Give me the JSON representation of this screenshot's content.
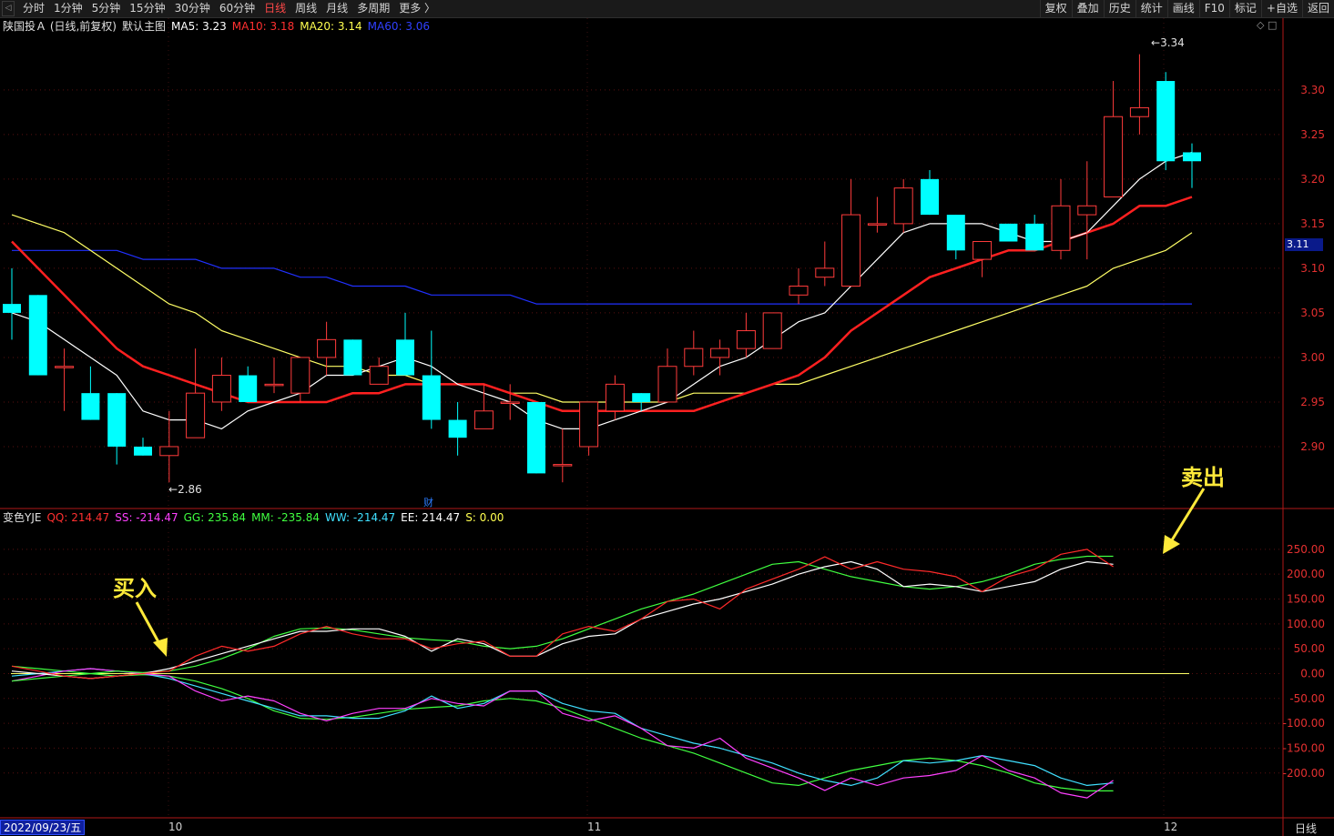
{
  "toolbar": {
    "periods": [
      "分时",
      "1分钟",
      "5分钟",
      "15分钟",
      "30分钟",
      "60分钟",
      "日线",
      "周线",
      "月线",
      "多周期",
      "更多 〉"
    ],
    "active_period": "日线",
    "right_buttons": [
      "复权",
      "叠加",
      "历史",
      "统计",
      "画线",
      "F10",
      "标记",
      "+自选",
      "返回"
    ]
  },
  "main_legend": {
    "stock": "陕国投Ａ (日线,前复权)",
    "template": "默认主图",
    "ma5": "MA5: 3.23",
    "ma10": "MA10: 3.18",
    "ma20": "MA20: 3.14",
    "ma60": "MA60: 3.06"
  },
  "indicator_legend": {
    "name": "变色YJE",
    "qq": "QQ: 214.47",
    "ss": "SS: -214.47",
    "gg": "GG: 235.84",
    "mm": "MM: -235.84",
    "ww": "WW: -214.47",
    "ee": "EE: 214.47",
    "s": "S: 0.00"
  },
  "colors": {
    "up": "#ff3b3b",
    "down": "#00ffff",
    "ma5": "#ffffff",
    "ma10": "#ff2020",
    "ma20": "#ffff66",
    "ma60": "#2030ff",
    "qq": "#ff2a2a",
    "ss": "#ff40ff",
    "gg": "#40ff40",
    "mm": "#40ff40",
    "ww": "#40e0ff",
    "ee": "#ffffff",
    "zero": "#ffff66"
  },
  "price_axis": [
    "3.30",
    "3.25",
    "3.20",
    "3.15",
    "3.10",
    "3.05",
    "3.00",
    "2.95",
    "2.90"
  ],
  "indicator_axis": [
    "250.00",
    "200.00",
    "150.00",
    "100.00",
    "50.00",
    "0.00",
    "-50.00",
    "-100.00",
    "-150.00",
    "-200.00"
  ],
  "current_price_tag": "3.11",
  "date_box": "2022/09/23/五",
  "period_label": "日线",
  "month_ticks": [
    "10",
    "11",
    "12"
  ],
  "extremes": {
    "high": "3.34",
    "low": "2.86"
  },
  "annotations": {
    "buy": "买入",
    "sell": "卖出"
  },
  "finance_badge": "财",
  "chart_data": {
    "type": "candlestick",
    "price_ylim": [
      2.85,
      3.36
    ],
    "indicator_ylim": [
      -270,
      290
    ],
    "candles": [
      {
        "o": 3.06,
        "h": 3.1,
        "l": 3.02,
        "c": 3.05
      },
      {
        "o": 3.07,
        "h": 3.07,
        "l": 2.98,
        "c": 2.98
      },
      {
        "o": 2.99,
        "h": 3.01,
        "l": 2.94,
        "c": 2.99
      },
      {
        "o": 2.96,
        "h": 2.99,
        "l": 2.93,
        "c": 2.93
      },
      {
        "o": 2.96,
        "h": 2.96,
        "l": 2.88,
        "c": 2.9
      },
      {
        "o": 2.9,
        "h": 2.91,
        "l": 2.89,
        "c": 2.89
      },
      {
        "o": 2.89,
        "h": 2.94,
        "l": 2.86,
        "c": 2.9
      },
      {
        "o": 2.91,
        "h": 3.01,
        "l": 2.91,
        "c": 2.96
      },
      {
        "o": 2.95,
        "h": 3.0,
        "l": 2.94,
        "c": 2.98
      },
      {
        "o": 2.98,
        "h": 2.99,
        "l": 2.95,
        "c": 2.95
      },
      {
        "o": 2.97,
        "h": 3.0,
        "l": 2.96,
        "c": 2.97
      },
      {
        "o": 2.96,
        "h": 3.0,
        "l": 2.95,
        "c": 3.0
      },
      {
        "o": 3.0,
        "h": 3.04,
        "l": 2.98,
        "c": 3.02
      },
      {
        "o": 3.02,
        "h": 3.02,
        "l": 2.98,
        "c": 2.98
      },
      {
        "o": 2.97,
        "h": 3.0,
        "l": 2.97,
        "c": 2.99
      },
      {
        "o": 3.02,
        "h": 3.05,
        "l": 2.98,
        "c": 2.98
      },
      {
        "o": 2.98,
        "h": 3.03,
        "l": 2.92,
        "c": 2.93
      },
      {
        "o": 2.93,
        "h": 2.95,
        "l": 2.89,
        "c": 2.91
      },
      {
        "o": 2.92,
        "h": 2.97,
        "l": 2.92,
        "c": 2.94
      },
      {
        "o": 2.95,
        "h": 2.97,
        "l": 2.93,
        "c": 2.95
      },
      {
        "o": 2.95,
        "h": 2.95,
        "l": 2.87,
        "c": 2.87
      },
      {
        "o": 2.88,
        "h": 2.92,
        "l": 2.86,
        "c": 2.88
      },
      {
        "o": 2.9,
        "h": 2.95,
        "l": 2.89,
        "c": 2.95
      },
      {
        "o": 2.94,
        "h": 2.98,
        "l": 2.93,
        "c": 2.97
      },
      {
        "o": 2.96,
        "h": 2.96,
        "l": 2.94,
        "c": 2.95
      },
      {
        "o": 2.95,
        "h": 3.01,
        "l": 2.95,
        "c": 2.99
      },
      {
        "o": 2.99,
        "h": 3.03,
        "l": 2.98,
        "c": 3.01
      },
      {
        "o": 3.0,
        "h": 3.02,
        "l": 2.98,
        "c": 3.01
      },
      {
        "o": 3.01,
        "h": 3.05,
        "l": 3.0,
        "c": 3.03
      },
      {
        "o": 3.01,
        "h": 3.05,
        "l": 3.01,
        "c": 3.05
      },
      {
        "o": 3.07,
        "h": 3.1,
        "l": 3.06,
        "c": 3.08
      },
      {
        "o": 3.09,
        "h": 3.13,
        "l": 3.08,
        "c": 3.1
      },
      {
        "o": 3.08,
        "h": 3.2,
        "l": 3.08,
        "c": 3.16
      },
      {
        "o": 3.15,
        "h": 3.18,
        "l": 3.14,
        "c": 3.15
      },
      {
        "o": 3.15,
        "h": 3.2,
        "l": 3.14,
        "c": 3.19
      },
      {
        "o": 3.2,
        "h": 3.21,
        "l": 3.16,
        "c": 3.16
      },
      {
        "o": 3.16,
        "h": 3.16,
        "l": 3.11,
        "c": 3.12
      },
      {
        "o": 3.11,
        "h": 3.13,
        "l": 3.09,
        "c": 3.13
      },
      {
        "o": 3.15,
        "h": 3.15,
        "l": 3.13,
        "c": 3.13
      },
      {
        "o": 3.15,
        "h": 3.16,
        "l": 3.12,
        "c": 3.12
      },
      {
        "o": 3.12,
        "h": 3.2,
        "l": 3.11,
        "c": 3.17
      },
      {
        "o": 3.16,
        "h": 3.22,
        "l": 3.11,
        "c": 3.17
      },
      {
        "o": 3.18,
        "h": 3.31,
        "l": 3.18,
        "c": 3.27
      },
      {
        "o": 3.27,
        "h": 3.34,
        "l": 3.25,
        "c": 3.28
      },
      {
        "o": 3.31,
        "h": 3.32,
        "l": 3.21,
        "c": 3.22
      },
      {
        "o": 3.23,
        "h": 3.24,
        "l": 3.19,
        "c": 3.22
      }
    ],
    "ma5": [
      3.05,
      3.04,
      3.02,
      3.0,
      2.98,
      2.94,
      2.93,
      2.93,
      2.92,
      2.94,
      2.95,
      2.96,
      2.98,
      2.98,
      2.99,
      3.0,
      2.99,
      2.97,
      2.96,
      2.95,
      2.93,
      2.92,
      2.92,
      2.93,
      2.94,
      2.95,
      2.97,
      2.99,
      3.0,
      3.02,
      3.04,
      3.05,
      3.08,
      3.11,
      3.14,
      3.15,
      3.15,
      3.15,
      3.14,
      3.13,
      3.13,
      3.14,
      3.17,
      3.2,
      3.22,
      3.23
    ],
    "ma10": [
      3.13,
      3.1,
      3.07,
      3.04,
      3.01,
      2.99,
      2.98,
      2.97,
      2.96,
      2.95,
      2.95,
      2.95,
      2.95,
      2.96,
      2.96,
      2.97,
      2.97,
      2.97,
      2.97,
      2.96,
      2.95,
      2.94,
      2.94,
      2.94,
      2.94,
      2.94,
      2.94,
      2.95,
      2.96,
      2.97,
      2.98,
      3.0,
      3.03,
      3.05,
      3.07,
      3.09,
      3.1,
      3.11,
      3.12,
      3.12,
      3.13,
      3.14,
      3.15,
      3.17,
      3.17,
      3.18
    ],
    "ma20": [
      3.16,
      3.15,
      3.14,
      3.12,
      3.1,
      3.08,
      3.06,
      3.05,
      3.03,
      3.02,
      3.01,
      3.0,
      2.99,
      2.99,
      2.98,
      2.98,
      2.97,
      2.97,
      2.97,
      2.96,
      2.96,
      2.95,
      2.95,
      2.95,
      2.95,
      2.95,
      2.96,
      2.96,
      2.96,
      2.97,
      2.97,
      2.98,
      2.99,
      3.0,
      3.01,
      3.02,
      3.03,
      3.04,
      3.05,
      3.06,
      3.07,
      3.08,
      3.1,
      3.11,
      3.12,
      3.14
    ],
    "ma60": [
      3.12,
      3.12,
      3.12,
      3.12,
      3.12,
      3.11,
      3.11,
      3.11,
      3.1,
      3.1,
      3.1,
      3.09,
      3.09,
      3.08,
      3.08,
      3.08,
      3.07,
      3.07,
      3.07,
      3.07,
      3.06,
      3.06,
      3.06,
      3.06,
      3.06,
      3.06,
      3.06,
      3.06,
      3.06,
      3.06,
      3.06,
      3.06,
      3.06,
      3.06,
      3.06,
      3.06,
      3.06,
      3.06,
      3.06,
      3.06,
      3.06,
      3.06,
      3.06,
      3.06,
      3.06,
      3.06
    ],
    "qq": [
      15,
      5,
      -5,
      -10,
      -5,
      0,
      5,
      35,
      55,
      45,
      55,
      80,
      95,
      80,
      70,
      70,
      50,
      60,
      65,
      35,
      35,
      80,
      95,
      85,
      110,
      145,
      150,
      130,
      170,
      190,
      210,
      235,
      210,
      225,
      210,
      205,
      195,
      165,
      195,
      210,
      240,
      250,
      215
    ],
    "ee": [
      5,
      0,
      -5,
      -10,
      -5,
      0,
      10,
      25,
      40,
      55,
      70,
      85,
      85,
      90,
      90,
      75,
      45,
      70,
      60,
      35,
      35,
      60,
      75,
      80,
      110,
      125,
      140,
      150,
      165,
      180,
      200,
      215,
      225,
      210,
      175,
      180,
      175,
      165,
      175,
      185,
      210,
      225,
      220
    ],
    "gg": [
      -15,
      -10,
      -5,
      0,
      5,
      2,
      5,
      15,
      30,
      50,
      75,
      90,
      92,
      88,
      80,
      72,
      68,
      65,
      55,
      50,
      55,
      70,
      90,
      110,
      130,
      145,
      160,
      180,
      200,
      220,
      225,
      210,
      195,
      185,
      175,
      170,
      175,
      185,
      200,
      220,
      230,
      236,
      236
    ],
    "ss": [
      -15,
      -5,
      5,
      10,
      5,
      0,
      -5,
      -35,
      -55,
      -45,
      -55,
      -80,
      -95,
      -80,
      -70,
      -70,
      -50,
      -60,
      -65,
      -35,
      -35,
      -80,
      -95,
      -85,
      -110,
      -145,
      -150,
      -130,
      -170,
      -190,
      -210,
      -235,
      -210,
      -225,
      -210,
      -205,
      -195,
      -165,
      -195,
      -210,
      -240,
      -250,
      -215
    ],
    "ww": [
      -5,
      0,
      5,
      10,
      5,
      0,
      -10,
      -25,
      -40,
      -55,
      -70,
      -85,
      -85,
      -90,
      -90,
      -75,
      -45,
      -70,
      -60,
      -35,
      -35,
      -60,
      -75,
      -80,
      -110,
      -125,
      -140,
      -150,
      -165,
      -180,
      -200,
      -215,
      -225,
      -210,
      -175,
      -180,
      -175,
      -165,
      -175,
      -185,
      -210,
      -225,
      -220
    ],
    "mm": [
      15,
      10,
      5,
      0,
      -5,
      -2,
      -5,
      -15,
      -30,
      -50,
      -75,
      -90,
      -92,
      -88,
      -80,
      -72,
      -68,
      -65,
      -55,
      -50,
      -55,
      -70,
      -90,
      -110,
      -130,
      -145,
      -160,
      -180,
      -200,
      -220,
      -225,
      -210,
      -195,
      -185,
      -175,
      -170,
      -175,
      -185,
      -200,
      -220,
      -230,
      -236,
      -236
    ]
  }
}
